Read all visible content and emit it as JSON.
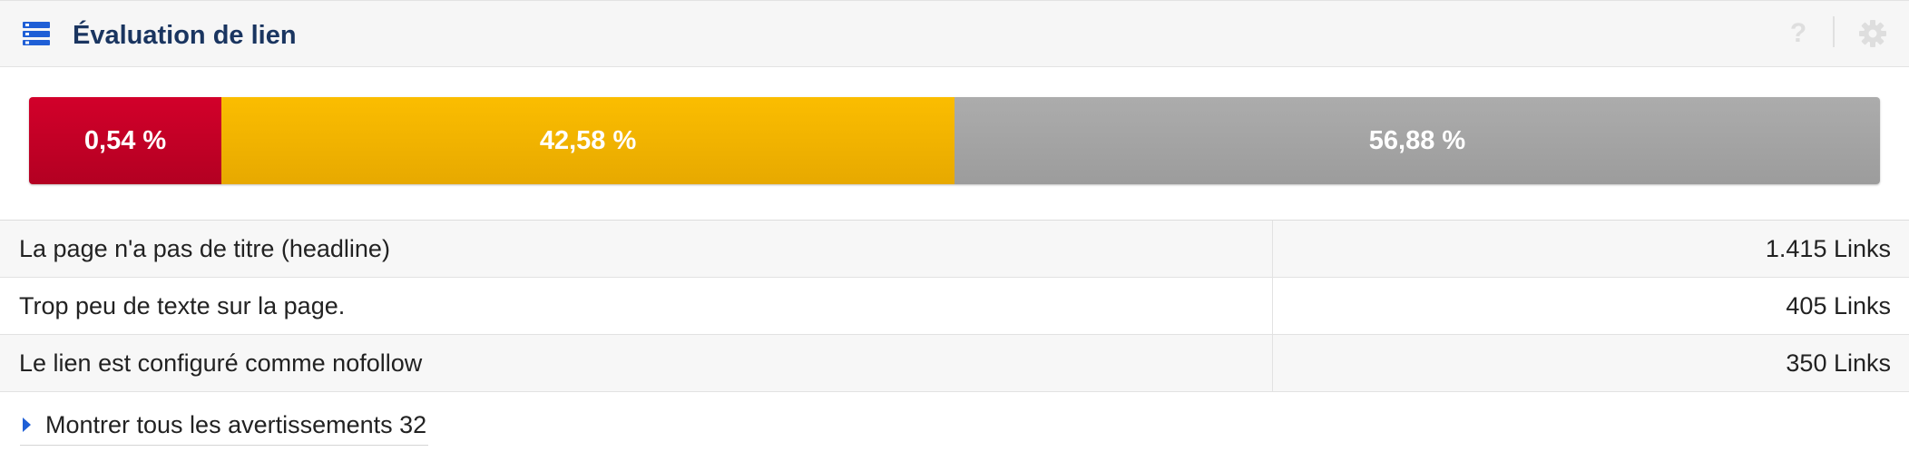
{
  "widget": {
    "title": "Évaluation de lien",
    "help_symbol": "?",
    "icons": {
      "header": "list-icon",
      "help": "help-icon",
      "settings": "gear-icon"
    }
  },
  "distribution": {
    "segments": [
      {
        "label": "0,54 %",
        "share_percent": 10.4,
        "color": "#c8002a"
      },
      {
        "label": "42,58 %",
        "share_percent": 39.6,
        "color": "#f7b500"
      },
      {
        "label": "56,88 %",
        "share_percent": 50.0,
        "color": "#a5a5a5"
      }
    ]
  },
  "warnings": {
    "rows": [
      {
        "label": "La page n'a pas de titre (headline)",
        "value": "1.415 Links"
      },
      {
        "label": "Trop peu de texte sur la page.",
        "value": "405 Links"
      },
      {
        "label": "Le lien est configuré comme nofollow",
        "value": "350 Links"
      }
    ],
    "show_all_label": "Montrer tous les avertissements 32"
  },
  "colors": {
    "accent": "#1f5fd6",
    "title": "#1a3560"
  }
}
